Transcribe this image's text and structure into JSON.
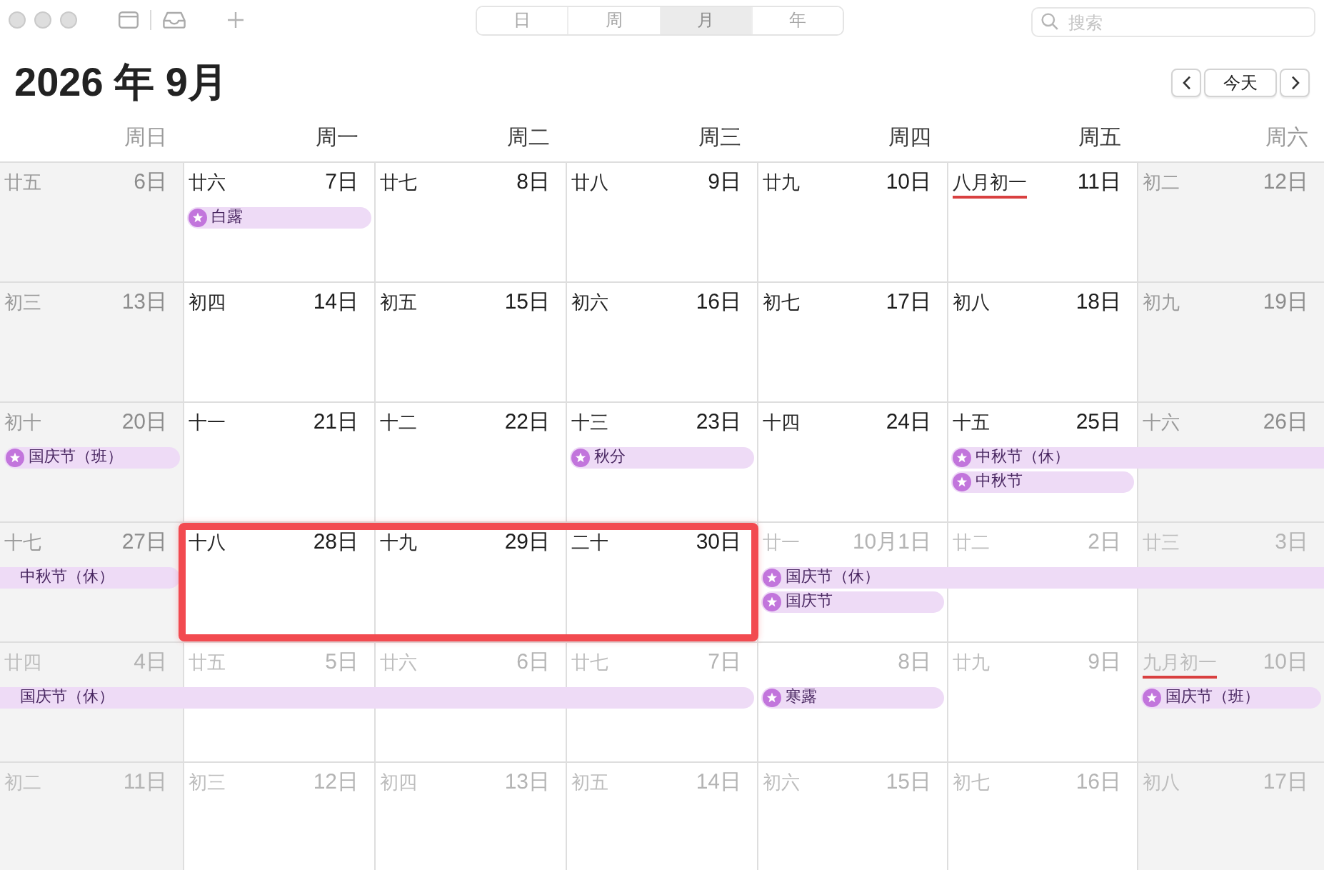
{
  "toolbar": {
    "view_tabs": [
      {
        "label": "日",
        "selected": false
      },
      {
        "label": "周",
        "selected": false
      },
      {
        "label": "月",
        "selected": true
      },
      {
        "label": "年",
        "selected": false
      }
    ],
    "search": {
      "placeholder": "搜索"
    }
  },
  "header": {
    "title": "2026 年 9月",
    "today_button": "今天"
  },
  "weekdays": [
    {
      "label": "周日",
      "weekend": true
    },
    {
      "label": "周一",
      "weekend": false
    },
    {
      "label": "周二",
      "weekend": false
    },
    {
      "label": "周三",
      "weekend": false
    },
    {
      "label": "周四",
      "weekend": false
    },
    {
      "label": "周五",
      "weekend": false
    },
    {
      "label": "周六",
      "weekend": true
    }
  ],
  "weeks": [
    {
      "days": [
        {
          "lunar": "廿五",
          "date": "6日",
          "in_month": true,
          "lunar_underline": false,
          "highlighted": false
        },
        {
          "lunar": "廿六",
          "date": "7日",
          "in_month": true,
          "lunar_underline": false,
          "highlighted": false,
          "events": [
            {
              "kind": "start",
              "title": "白露"
            }
          ]
        },
        {
          "lunar": "廿七",
          "date": "8日",
          "in_month": true,
          "lunar_underline": false,
          "highlighted": false
        },
        {
          "lunar": "廿八",
          "date": "9日",
          "in_month": true,
          "lunar_underline": false,
          "highlighted": false
        },
        {
          "lunar": "廿九",
          "date": "10日",
          "in_month": true,
          "lunar_underline": false,
          "highlighted": false
        },
        {
          "lunar": "八月初一",
          "date": "11日",
          "in_month": true,
          "lunar_underline": true,
          "highlighted": false
        },
        {
          "lunar": "初二",
          "date": "12日",
          "in_month": true,
          "lunar_underline": false,
          "highlighted": false
        }
      ]
    },
    {
      "days": [
        {
          "lunar": "初三",
          "date": "13日",
          "in_month": true,
          "lunar_underline": false,
          "highlighted": false
        },
        {
          "lunar": "初四",
          "date": "14日",
          "in_month": true,
          "lunar_underline": false,
          "highlighted": false
        },
        {
          "lunar": "初五",
          "date": "15日",
          "in_month": true,
          "lunar_underline": false,
          "highlighted": false
        },
        {
          "lunar": "初六",
          "date": "16日",
          "in_month": true,
          "lunar_underline": false,
          "highlighted": false
        },
        {
          "lunar": "初七",
          "date": "17日",
          "in_month": true,
          "lunar_underline": false,
          "highlighted": false
        },
        {
          "lunar": "初八",
          "date": "18日",
          "in_month": true,
          "lunar_underline": false,
          "highlighted": false
        },
        {
          "lunar": "初九",
          "date": "19日",
          "in_month": true,
          "lunar_underline": false,
          "highlighted": false
        }
      ]
    },
    {
      "days": [
        {
          "lunar": "初十",
          "date": "20日",
          "in_month": true,
          "lunar_underline": false,
          "highlighted": false,
          "events": [
            {
              "kind": "start",
              "title": "国庆节（班）"
            }
          ]
        },
        {
          "lunar": "十一",
          "date": "21日",
          "in_month": true,
          "lunar_underline": false,
          "highlighted": false
        },
        {
          "lunar": "十二",
          "date": "22日",
          "in_month": true,
          "lunar_underline": false,
          "highlighted": false
        },
        {
          "lunar": "十三",
          "date": "23日",
          "in_month": true,
          "lunar_underline": false,
          "highlighted": false,
          "events": [
            {
              "kind": "start",
              "title": "秋分"
            }
          ]
        },
        {
          "lunar": "十四",
          "date": "24日",
          "in_month": true,
          "lunar_underline": false,
          "highlighted": false
        },
        {
          "lunar": "十五",
          "date": "25日",
          "in_month": true,
          "lunar_underline": false,
          "highlighted": false,
          "events": [
            {
              "kind": "start",
              "title": "中秋节（休）"
            },
            {
              "kind": "start",
              "title": "中秋节"
            }
          ]
        },
        {
          "lunar": "十六",
          "date": "26日",
          "in_month": true,
          "lunar_underline": false,
          "highlighted": false,
          "events": [
            {
              "kind": "continue"
            }
          ]
        }
      ]
    },
    {
      "days": [
        {
          "lunar": "十七",
          "date": "27日",
          "in_month": true,
          "lunar_underline": false,
          "highlighted": false,
          "events": [
            {
              "kind": "continue",
              "title": "中秋节（休）"
            }
          ]
        },
        {
          "lunar": "十八",
          "date": "28日",
          "in_month": true,
          "lunar_underline": false,
          "highlighted": true
        },
        {
          "lunar": "十九",
          "date": "29日",
          "in_month": true,
          "lunar_underline": false,
          "highlighted": true
        },
        {
          "lunar": "二十",
          "date": "30日",
          "in_month": true,
          "lunar_underline": false,
          "highlighted": true
        },
        {
          "lunar": "廿一",
          "date": "10月1日",
          "in_month": false,
          "lunar_underline": false,
          "highlighted": false,
          "events": [
            {
              "kind": "start",
              "title": "国庆节（休）"
            },
            {
              "kind": "start",
              "title": "国庆节"
            }
          ]
        },
        {
          "lunar": "廿二",
          "date": "2日",
          "in_month": false,
          "lunar_underline": false,
          "highlighted": false,
          "events": [
            {
              "kind": "continue"
            }
          ]
        },
        {
          "lunar": "廿三",
          "date": "3日",
          "in_month": false,
          "lunar_underline": false,
          "highlighted": false,
          "events": [
            {
              "kind": "continue"
            }
          ]
        }
      ]
    },
    {
      "days": [
        {
          "lunar": "廿四",
          "date": "4日",
          "in_month": false,
          "lunar_underline": false,
          "highlighted": false,
          "events": [
            {
              "kind": "continue",
              "title": "国庆节（休）"
            }
          ]
        },
        {
          "lunar": "廿五",
          "date": "5日",
          "in_month": false,
          "lunar_underline": false,
          "highlighted": false,
          "events": [
            {
              "kind": "continue"
            }
          ]
        },
        {
          "lunar": "廿六",
          "date": "6日",
          "in_month": false,
          "lunar_underline": false,
          "highlighted": false,
          "events": [
            {
              "kind": "continue"
            }
          ]
        },
        {
          "lunar": "廿七",
          "date": "7日",
          "in_month": false,
          "lunar_underline": false,
          "highlighted": false,
          "events": [
            {
              "kind": "continue"
            }
          ]
        },
        {
          "date": "8日",
          "in_month": false,
          "highlighted": false,
          "events": [
            {
              "kind": "start",
              "title": "寒露"
            }
          ]
        },
        {
          "lunar": "廿九",
          "date": "9日",
          "in_month": false,
          "lunar_underline": false,
          "highlighted": false
        },
        {
          "lunar": "九月初一",
          "date": "10日",
          "in_month": false,
          "lunar_underline": true,
          "highlighted": false,
          "events": [
            {
              "kind": "start",
              "title": "国庆节（班）"
            }
          ]
        }
      ]
    },
    {
      "days": [
        {
          "lunar": "初二",
          "date": "11日",
          "in_month": false,
          "lunar_underline": false,
          "highlighted": false
        },
        {
          "lunar": "初三",
          "date": "12日",
          "in_month": false,
          "lunar_underline": false,
          "highlighted": false
        },
        {
          "lunar": "初四",
          "date": "13日",
          "in_month": false,
          "lunar_underline": false,
          "highlighted": false
        },
        {
          "lunar": "初五",
          "date": "14日",
          "in_month": false,
          "lunar_underline": false,
          "highlighted": false
        },
        {
          "lunar": "初六",
          "date": "15日",
          "in_month": false,
          "lunar_underline": false,
          "highlighted": false
        },
        {
          "lunar": "初七",
          "date": "16日",
          "in_month": false,
          "lunar_underline": false,
          "highlighted": false
        },
        {
          "lunar": "初八",
          "date": "17日",
          "in_month": false,
          "lunar_underline": false,
          "highlighted": false
        }
      ]
    }
  ]
}
